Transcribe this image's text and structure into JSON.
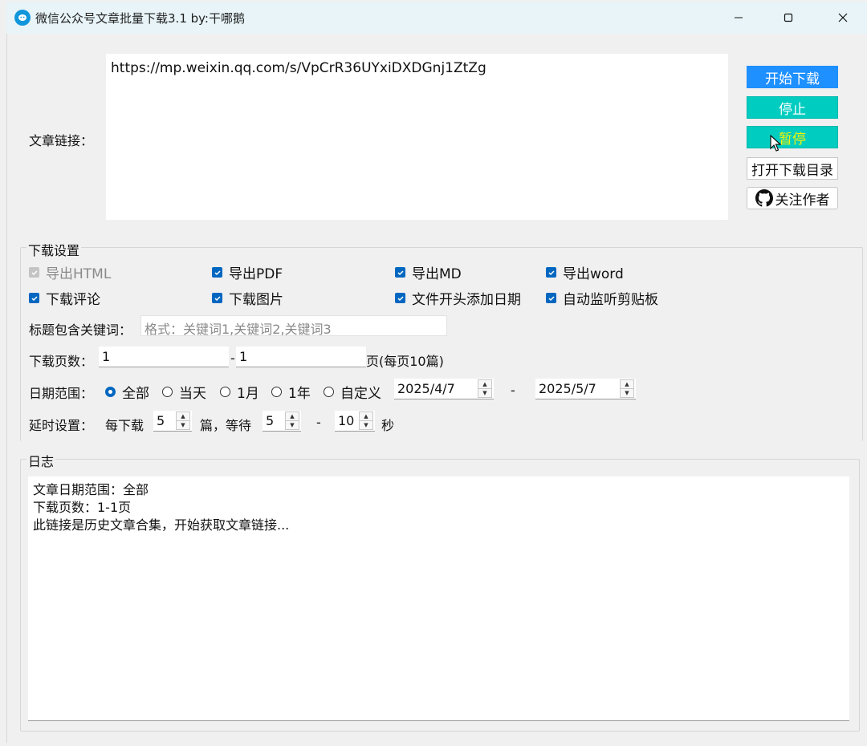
{
  "window": {
    "title": "微信公众号文章批量下载3.1 by:干哪鹅",
    "minimize": "—",
    "maximize": "☐",
    "close": "✕"
  },
  "link": {
    "label": "文章链接：",
    "value": "https://mp.weixin.qq.com/s/VpCrR36UYxiDXDGnj1ZtZg"
  },
  "buttons": {
    "start": "开始下载",
    "stop": "停止",
    "pause": "暂停",
    "open_dir": "打开下载目录",
    "follow": "关注作者"
  },
  "settings": {
    "group_title": "下载设置",
    "checkboxes": [
      {
        "label": "导出HTML",
        "checked": true,
        "disabled": true
      },
      {
        "label": "导出PDF",
        "checked": true,
        "disabled": false
      },
      {
        "label": "导出MD",
        "checked": true,
        "disabled": false
      },
      {
        "label": "导出word",
        "checked": true,
        "disabled": false
      },
      {
        "label": "下载评论",
        "checked": true,
        "disabled": false
      },
      {
        "label": "下载图片",
        "checked": true,
        "disabled": false
      },
      {
        "label": "文件开头添加日期",
        "checked": true,
        "disabled": false
      },
      {
        "label": "自动监听剪贴板",
        "checked": true,
        "disabled": false
      }
    ],
    "keyword_label": "标题包含关键词：",
    "keyword_placeholder": "格式：关键词1,关键词2,关键词3",
    "pages_label": "下载页数：",
    "page_from": "1",
    "page_dash": "-",
    "page_to": "1",
    "page_suffix": "页(每页10篇)",
    "date_label": "日期范围：",
    "date_options": [
      "全部",
      "当天",
      "1月",
      "1年",
      "自定义"
    ],
    "date_selected": "全部",
    "date_from": "2025/4/7",
    "date_dash": "-",
    "date_to": "2025/5/7",
    "delay_label": "延时设置：",
    "delay_every": "每下载",
    "delay_count": "5",
    "delay_mid": "篇，等待",
    "delay_min": "5",
    "delay_dash": "-",
    "delay_max": "10",
    "delay_unit": "秒"
  },
  "log": {
    "group_title": "日志",
    "lines": [
      "文章日期范围：全部",
      "下载页数：1-1页",
      "此链接是历史文章合集，开始获取文章链接..."
    ]
  },
  "colors": {
    "start_button": "#1e90ff",
    "stop_button": "#00ccc0",
    "pause_text": "#f5f500",
    "checkbox": "#0067c0",
    "titlebar": "#e8f4f8"
  },
  "icons": {
    "app": "app-logo-icon",
    "github": "github-icon",
    "cursor": "mouse-cursor-icon"
  }
}
